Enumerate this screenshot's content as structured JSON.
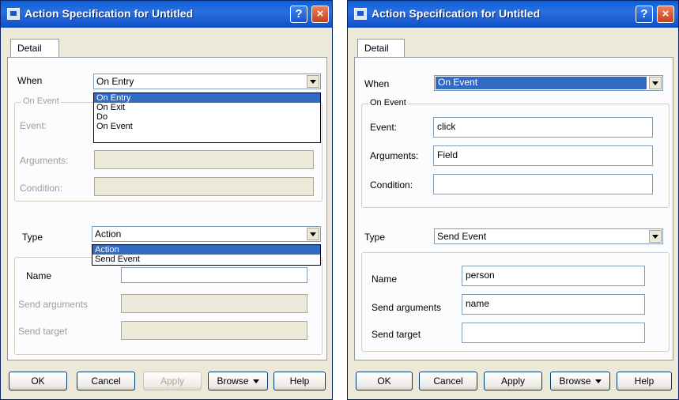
{
  "left_dialog": {
    "title": "Action Specification for Untitled",
    "tab": "Detail",
    "when_label": "When",
    "when_value": "On Entry",
    "when_options": [
      "On Entry",
      "On Exit",
      "Do",
      "On Event"
    ],
    "on_event_group": "On Event",
    "event_label": "Event:",
    "arguments_label": "Arguments:",
    "condition_label": "Condition:",
    "type_label": "Type",
    "type_value": "Action",
    "type_options": [
      "Action",
      "Send Event"
    ],
    "name_label": "Name",
    "send_arguments_label": "Send arguments",
    "send_target_label": "Send target",
    "buttons": {
      "ok": "OK",
      "cancel": "Cancel",
      "apply": "Apply",
      "browse": "Browse",
      "help": "Help"
    }
  },
  "right_dialog": {
    "title": "Action Specification for Untitled",
    "tab": "Detail",
    "when_label": "When",
    "when_value": "On Event",
    "on_event_group": "On Event",
    "event_label": "Event:",
    "event_value": "click",
    "arguments_label": "Arguments:",
    "arguments_value": "Field",
    "condition_label": "Condition:",
    "condition_value": "",
    "type_label": "Type",
    "type_value": "Send Event",
    "name_label": "Name",
    "name_value": "person",
    "send_arguments_label": "Send arguments",
    "send_arguments_value": "name",
    "send_target_label": "Send target",
    "send_target_value": "",
    "buttons": {
      "ok": "OK",
      "cancel": "Cancel",
      "apply": "Apply",
      "browse": "Browse",
      "help": "Help"
    }
  },
  "titlebar_buttons": {
    "help": "?",
    "close": "×"
  },
  "colors": {
    "title_bar": "#0a5fd8",
    "selection": "#316ac5",
    "close": "#c8401c"
  }
}
